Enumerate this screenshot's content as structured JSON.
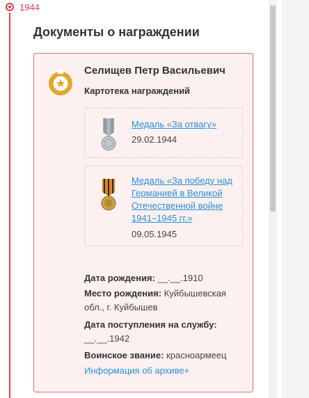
{
  "timeline": {
    "year": "1944",
    "accent_color": "#e23a4f"
  },
  "section": {
    "title": "Документы о награждении"
  },
  "card": {
    "person_name": "Селищев Петр Васильевич",
    "subtitle": "Картотека награждений",
    "badge_icon": "award-star-icon",
    "medals": [
      {
        "title": "Медаль «За отвагу»",
        "date": "29.02.1944",
        "icon": "medal-for-courage-icon"
      },
      {
        "title": "Медаль «За победу над Германией в Великой Отечественной войне 1941–1945 гг.»",
        "date": "09.05.1945",
        "icon": "medal-victory-over-germany-icon"
      }
    ],
    "info": {
      "birth_date_label": "Дата рождения:",
      "birth_date_value": " __.__.1910",
      "birth_place_label": "Место рождения:",
      "birth_place_value": " Куйбышевская обл., г. Куйбышев",
      "service_date_label": "Дата поступления на службу:",
      "service_date_value": " __.__.1942",
      "rank_label": "Воинское звание:",
      "rank_value": " красноармеец"
    },
    "archive_link": "Информация об архиве+"
  },
  "colors": {
    "link": "#2b8fd6",
    "card_border": "#e26a73",
    "card_bg": "#fcf1f0",
    "badge_gold": "#e1a82a"
  }
}
